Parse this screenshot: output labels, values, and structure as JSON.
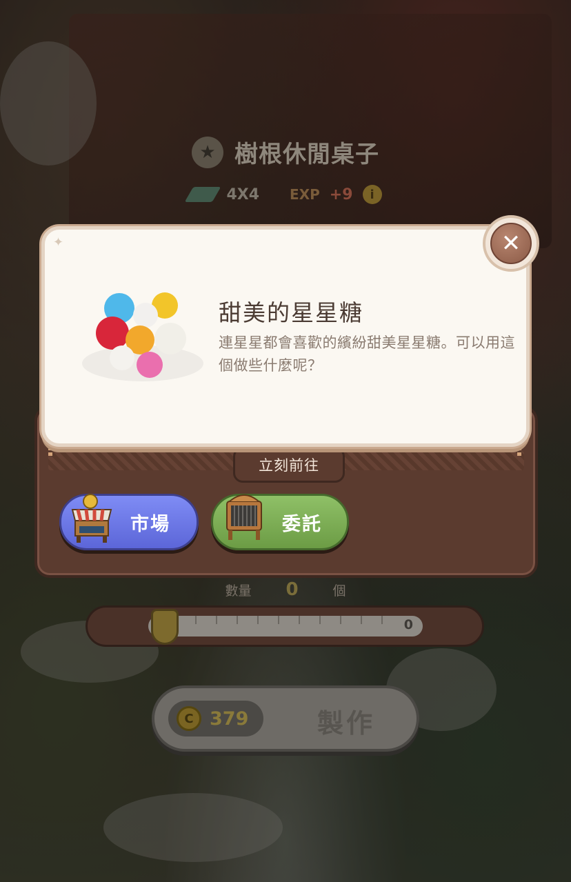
{
  "item": {
    "name": "樹根休閒桌子",
    "size": "4X4",
    "exp_label": "EXP",
    "exp_value": "+9",
    "icon": "star-icon"
  },
  "popup": {
    "title": "甜美的星星糖",
    "description": "連星星都會喜歡的繽紛甜美星星糖。可以用這個做些什麼呢？",
    "close_icon": "close-icon"
  },
  "go_panel": {
    "tab_label": "立刻前往",
    "market_label": "市場",
    "commission_label": "委託"
  },
  "quantity": {
    "label": "數量",
    "value": "0",
    "unit": "個",
    "slider_value": "0",
    "slider_fraction": 0
  },
  "craft": {
    "cost": "379",
    "label": "製作"
  },
  "colors": {
    "market_button": "#6d78e6",
    "commission_button": "#7dae55",
    "panel_brown": "#5b3b2f",
    "popup_bg": "#fbf8f2"
  }
}
